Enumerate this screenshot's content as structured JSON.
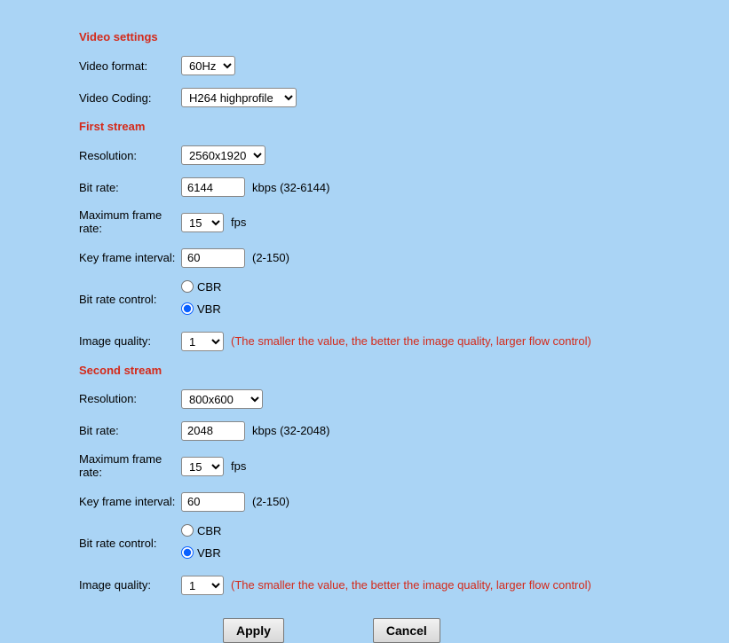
{
  "headers": {
    "video_settings": "Video settings",
    "first_stream": "First stream",
    "second_stream": "Second stream"
  },
  "labels": {
    "video_format": "Video format:",
    "video_coding": "Video Coding:",
    "resolution": "Resolution:",
    "bit_rate": "Bit rate:",
    "max_frame_rate": "Maximum frame rate:",
    "key_frame_interval": "Key frame interval:",
    "bit_rate_control": "Bit rate control:",
    "image_quality": "Image quality:"
  },
  "video_settings": {
    "video_format": "60Hz",
    "video_coding": "H264 highprofile"
  },
  "stream1": {
    "resolution": "2560x1920",
    "bit_rate": "6144",
    "bit_rate_hint": "kbps (32-6144)",
    "max_frame_rate": "15",
    "fps_hint": "fps",
    "key_frame_interval": "60",
    "key_frame_hint": "(2-150)",
    "brc_cbr": "CBR",
    "brc_vbr": "VBR",
    "image_quality": "1",
    "iq_hint": "(The smaller the value, the better the image quality, larger flow control)"
  },
  "stream2": {
    "resolution": "800x600",
    "bit_rate": "2048",
    "bit_rate_hint": "kbps (32-2048)",
    "max_frame_rate": "15",
    "fps_hint": "fps",
    "key_frame_interval": "60",
    "key_frame_hint": "(2-150)",
    "brc_cbr": "CBR",
    "brc_vbr": "VBR",
    "image_quality": "1",
    "iq_hint": "(The smaller the value, the better the image quality, larger flow control)"
  },
  "buttons": {
    "apply": "Apply",
    "cancel": "Cancel"
  }
}
